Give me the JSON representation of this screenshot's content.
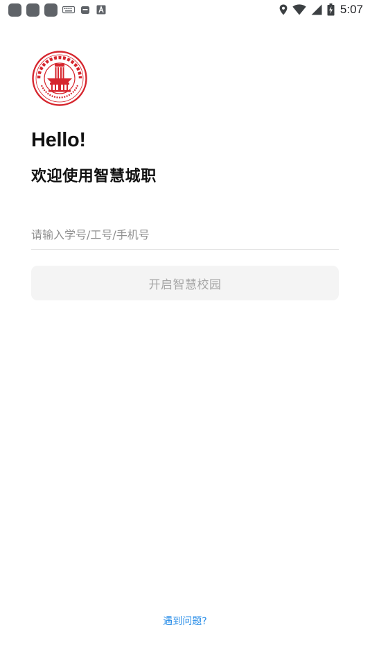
{
  "status_bar": {
    "time": "5:07",
    "left_icons": [
      "app-notification-icon",
      "app-notification-icon",
      "app-notification-icon",
      "keyboard-icon",
      "android-debug-icon",
      "text-a-icon"
    ],
    "right_icons": [
      "location-icon",
      "wifi-icon",
      "cellular-signal-icon",
      "battery-charging-icon"
    ]
  },
  "brand": {
    "logo_icon": "college-seal-icon",
    "logo_color": "#d6262e"
  },
  "header": {
    "greeting": "Hello!",
    "welcome": "欢迎使用智慧城职"
  },
  "login": {
    "id_input": {
      "value": "",
      "placeholder": "请输入学号/工号/手机号"
    },
    "start_button": "开启智慧校园"
  },
  "footer": {
    "help_link": "遇到问题?",
    "link_color": "#2a8ee8"
  }
}
